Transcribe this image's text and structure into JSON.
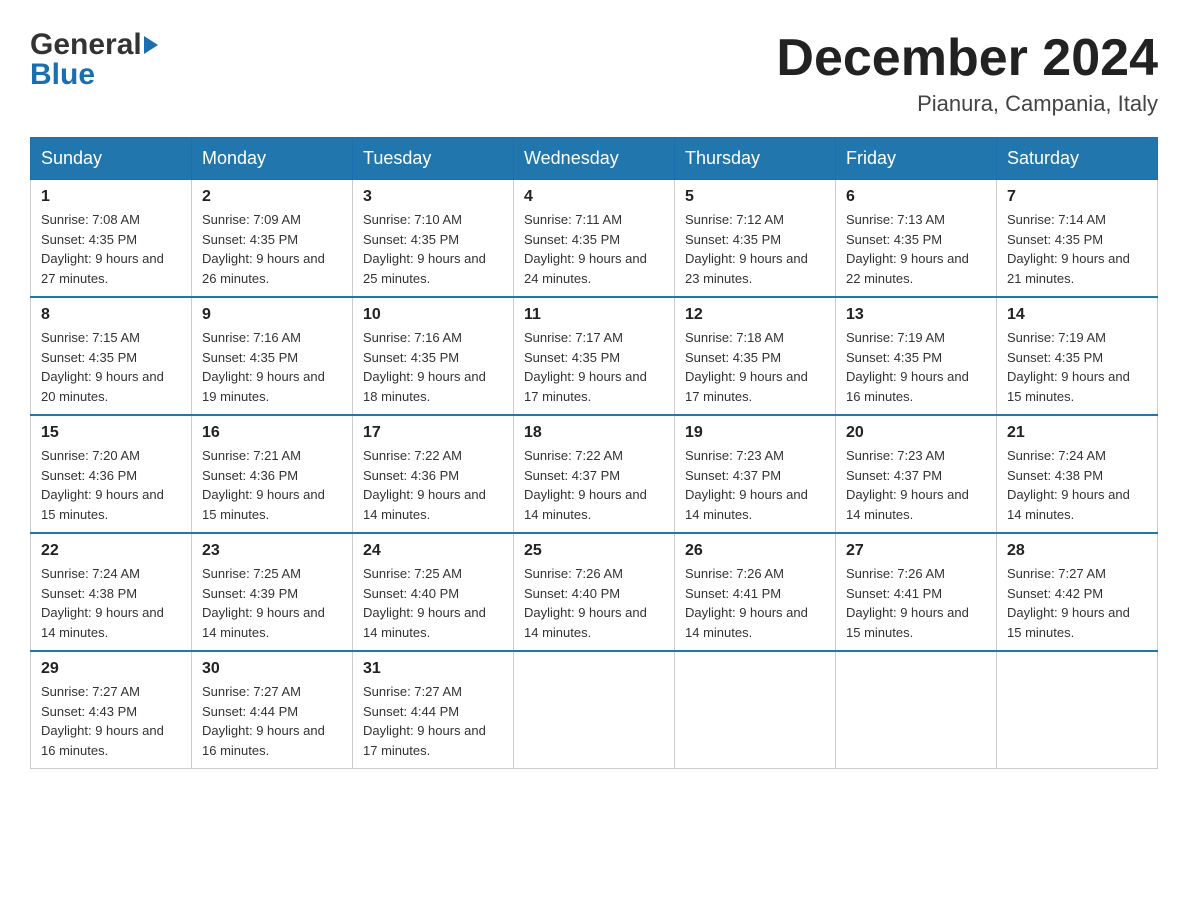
{
  "header": {
    "logo": {
      "general": "General",
      "blue": "Blue",
      "triangle_alt": "triangle logo"
    },
    "month_title": "December 2024",
    "location": "Pianura, Campania, Italy"
  },
  "calendar": {
    "days_of_week": [
      "Sunday",
      "Monday",
      "Tuesday",
      "Wednesday",
      "Thursday",
      "Friday",
      "Saturday"
    ],
    "weeks": [
      [
        {
          "day": "1",
          "sunrise": "7:08 AM",
          "sunset": "4:35 PM",
          "daylight": "9 hours and 27 minutes."
        },
        {
          "day": "2",
          "sunrise": "7:09 AM",
          "sunset": "4:35 PM",
          "daylight": "9 hours and 26 minutes."
        },
        {
          "day": "3",
          "sunrise": "7:10 AM",
          "sunset": "4:35 PM",
          "daylight": "9 hours and 25 minutes."
        },
        {
          "day": "4",
          "sunrise": "7:11 AM",
          "sunset": "4:35 PM",
          "daylight": "9 hours and 24 minutes."
        },
        {
          "day": "5",
          "sunrise": "7:12 AM",
          "sunset": "4:35 PM",
          "daylight": "9 hours and 23 minutes."
        },
        {
          "day": "6",
          "sunrise": "7:13 AM",
          "sunset": "4:35 PM",
          "daylight": "9 hours and 22 minutes."
        },
        {
          "day": "7",
          "sunrise": "7:14 AM",
          "sunset": "4:35 PM",
          "daylight": "9 hours and 21 minutes."
        }
      ],
      [
        {
          "day": "8",
          "sunrise": "7:15 AM",
          "sunset": "4:35 PM",
          "daylight": "9 hours and 20 minutes."
        },
        {
          "day": "9",
          "sunrise": "7:16 AM",
          "sunset": "4:35 PM",
          "daylight": "9 hours and 19 minutes."
        },
        {
          "day": "10",
          "sunrise": "7:16 AM",
          "sunset": "4:35 PM",
          "daylight": "9 hours and 18 minutes."
        },
        {
          "day": "11",
          "sunrise": "7:17 AM",
          "sunset": "4:35 PM",
          "daylight": "9 hours and 17 minutes."
        },
        {
          "day": "12",
          "sunrise": "7:18 AM",
          "sunset": "4:35 PM",
          "daylight": "9 hours and 17 minutes."
        },
        {
          "day": "13",
          "sunrise": "7:19 AM",
          "sunset": "4:35 PM",
          "daylight": "9 hours and 16 minutes."
        },
        {
          "day": "14",
          "sunrise": "7:19 AM",
          "sunset": "4:35 PM",
          "daylight": "9 hours and 15 minutes."
        }
      ],
      [
        {
          "day": "15",
          "sunrise": "7:20 AM",
          "sunset": "4:36 PM",
          "daylight": "9 hours and 15 minutes."
        },
        {
          "day": "16",
          "sunrise": "7:21 AM",
          "sunset": "4:36 PM",
          "daylight": "9 hours and 15 minutes."
        },
        {
          "day": "17",
          "sunrise": "7:22 AM",
          "sunset": "4:36 PM",
          "daylight": "9 hours and 14 minutes."
        },
        {
          "day": "18",
          "sunrise": "7:22 AM",
          "sunset": "4:37 PM",
          "daylight": "9 hours and 14 minutes."
        },
        {
          "day": "19",
          "sunrise": "7:23 AM",
          "sunset": "4:37 PM",
          "daylight": "9 hours and 14 minutes."
        },
        {
          "day": "20",
          "sunrise": "7:23 AM",
          "sunset": "4:37 PM",
          "daylight": "9 hours and 14 minutes."
        },
        {
          "day": "21",
          "sunrise": "7:24 AM",
          "sunset": "4:38 PM",
          "daylight": "9 hours and 14 minutes."
        }
      ],
      [
        {
          "day": "22",
          "sunrise": "7:24 AM",
          "sunset": "4:38 PM",
          "daylight": "9 hours and 14 minutes."
        },
        {
          "day": "23",
          "sunrise": "7:25 AM",
          "sunset": "4:39 PM",
          "daylight": "9 hours and 14 minutes."
        },
        {
          "day": "24",
          "sunrise": "7:25 AM",
          "sunset": "4:40 PM",
          "daylight": "9 hours and 14 minutes."
        },
        {
          "day": "25",
          "sunrise": "7:26 AM",
          "sunset": "4:40 PM",
          "daylight": "9 hours and 14 minutes."
        },
        {
          "day": "26",
          "sunrise": "7:26 AM",
          "sunset": "4:41 PM",
          "daylight": "9 hours and 14 minutes."
        },
        {
          "day": "27",
          "sunrise": "7:26 AM",
          "sunset": "4:41 PM",
          "daylight": "9 hours and 15 minutes."
        },
        {
          "day": "28",
          "sunrise": "7:27 AM",
          "sunset": "4:42 PM",
          "daylight": "9 hours and 15 minutes."
        }
      ],
      [
        {
          "day": "29",
          "sunrise": "7:27 AM",
          "sunset": "4:43 PM",
          "daylight": "9 hours and 16 minutes."
        },
        {
          "day": "30",
          "sunrise": "7:27 AM",
          "sunset": "4:44 PM",
          "daylight": "9 hours and 16 minutes."
        },
        {
          "day": "31",
          "sunrise": "7:27 AM",
          "sunset": "4:44 PM",
          "daylight": "9 hours and 17 minutes."
        },
        null,
        null,
        null,
        null
      ]
    ]
  }
}
